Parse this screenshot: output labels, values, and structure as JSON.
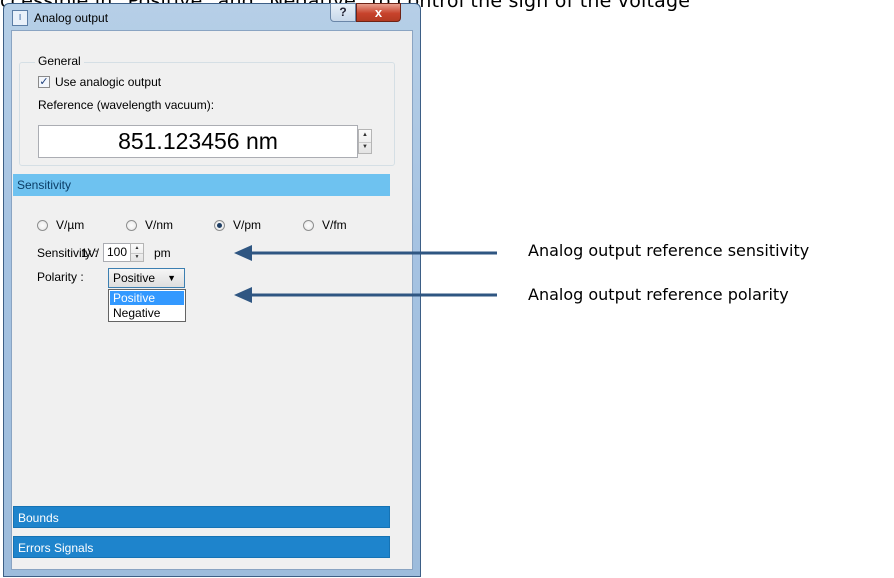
{
  "doc": {
    "top_text": "ccessible in \"Positive\" and \"Negative\" to control the sign of the voltage"
  },
  "window": {
    "title": "Analog output",
    "app_icon": "app-icon",
    "help_label": "?",
    "close_label": "x"
  },
  "general": {
    "group_label": "General",
    "use_analog_checked": true,
    "use_analog_label": "Use analogic output",
    "reference_label": "Reference (wavelength vacuum):",
    "reference_value": "851.123456 nm",
    "spin_up": "▲",
    "spin_down": "▼"
  },
  "sections": {
    "sensitivity": "Sensitivity",
    "bounds": "Bounds",
    "errors": "Errors Signals"
  },
  "units": {
    "options": [
      "V/µm",
      "V/nm",
      "V/pm",
      "V/fm"
    ],
    "selected": "V/pm"
  },
  "sensitivity_row": {
    "label": "Sensitivity :",
    "prefix": "1V/",
    "value": "100",
    "unit": "pm"
  },
  "polarity": {
    "label": "Polarity :",
    "selected": "Positive",
    "caret": "▼",
    "options": [
      "Positive",
      "Negative"
    ],
    "highlighted": "Positive"
  },
  "annotations": {
    "sensitivity": "Analog output reference sensitivity",
    "polarity": "Analog output reference polarity",
    "color": "#2f5682"
  }
}
